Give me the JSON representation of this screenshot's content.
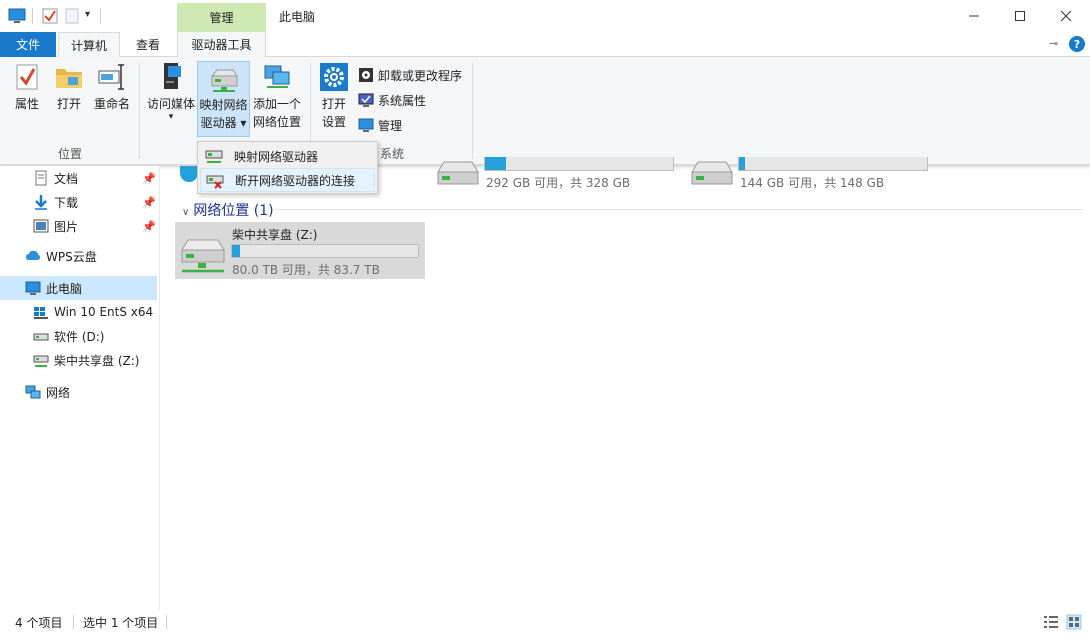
{
  "window": {
    "title": "此电脑",
    "context_group": "管理"
  },
  "tabs": {
    "file": "文件",
    "computer": "计算机",
    "view": "查看",
    "drive_tools": "驱动器工具"
  },
  "ribbon": {
    "location": {
      "group_label": "位置",
      "properties": "属性",
      "open": "打开",
      "rename": "重命名"
    },
    "network": {
      "access_media": "访问媒体",
      "map_drive_line1": "映射网络",
      "map_drive_line2": "驱动器",
      "add_location_line1": "添加一个",
      "add_location_line2": "网络位置"
    },
    "system": {
      "group_label": "系统",
      "open_settings_line1": "打开",
      "open_settings_line2": "设置",
      "uninstall": "卸载或更改程序",
      "system_properties": "系统属性",
      "manage": "管理"
    }
  },
  "dropdown": {
    "items": [
      "映射网络驱动器",
      "断开网络驱动器的连接"
    ]
  },
  "nav": {
    "items": [
      {
        "label": "文档",
        "pinned": true
      },
      {
        "label": "下载",
        "pinned": true
      },
      {
        "label": "图片",
        "pinned": true
      },
      {
        "label": "WPS云盘"
      },
      {
        "label": "此电脑",
        "selected": true
      },
      {
        "label": "Win 10 EntS x64 (("
      },
      {
        "label": "软件 (D:)"
      },
      {
        "label": "柴中共享盘 (Z:)"
      },
      {
        "label": "网络"
      }
    ]
  },
  "content": {
    "drives": [
      {
        "free_text": "292 GB 可用，共 328 GB",
        "used_fraction": 0.11
      },
      {
        "free_text": "144 GB 可用，共 148 GB",
        "used_fraction": 0.03
      }
    ],
    "network_section_title": "网络位置 (1)",
    "network_drive": {
      "name": "柴中共享盘 (Z:)",
      "free_text": "80.0 TB 可用，共 83.7 TB",
      "used_fraction": 0.044
    }
  },
  "status": {
    "item_count": "4 个项目",
    "selected_count": "选中 1 个项目"
  },
  "colors": {
    "accent": "#1979ca",
    "context_tab": "#cfe9b4",
    "selection": "#cce8ff",
    "usage_bar": "#26a0da"
  }
}
